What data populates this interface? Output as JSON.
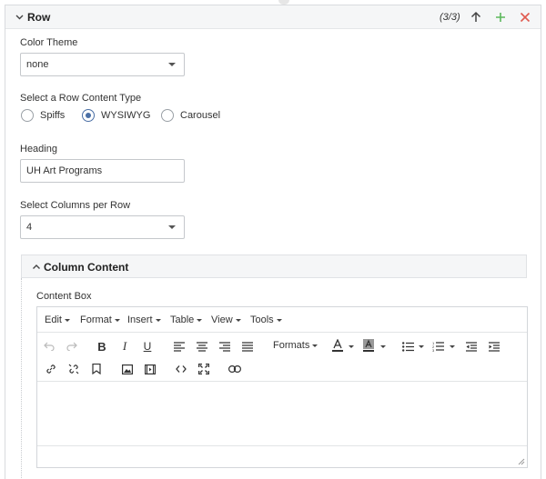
{
  "panel": {
    "title": "Row",
    "counter": "(3/3)",
    "buttons": {
      "move_up": "arrow-up-icon",
      "add": "plus-icon",
      "remove": "close-icon"
    },
    "colors": {
      "add": "#5cb85c",
      "remove": "#e05a4f"
    }
  },
  "color_theme": {
    "label": "Color Theme",
    "value": "none"
  },
  "content_type": {
    "label": "Select a Row Content Type",
    "options": [
      "Spiffs",
      "WYSIWYG",
      "Carousel"
    ],
    "selected": "WYSIWYG"
  },
  "heading": {
    "label": "Heading",
    "value": "UH Art Programs"
  },
  "columns": {
    "label": "Select Columns per Row",
    "value": "4"
  },
  "column_content": {
    "title": "Column Content",
    "content_box_label": "Content Box",
    "menus": [
      "Edit",
      "Format",
      "Insert",
      "Table",
      "View",
      "Tools"
    ],
    "toolbar": {
      "formats_label": "Formats",
      "icons_row1": [
        "undo-icon",
        "redo-icon",
        "bold-icon",
        "italic-icon",
        "underline-icon",
        "align-left-icon",
        "align-center-icon",
        "align-right-icon",
        "align-justify-icon",
        "text-color-icon",
        "background-color-icon",
        "bullet-list-icon",
        "numbered-list-icon",
        "outdent-icon",
        "indent-icon"
      ],
      "icons_row2": [
        "link-icon",
        "unlink-icon",
        "bookmark-icon",
        "image-icon",
        "media-icon",
        "code-icon",
        "fullscreen-icon",
        "chain-icon"
      ]
    }
  }
}
